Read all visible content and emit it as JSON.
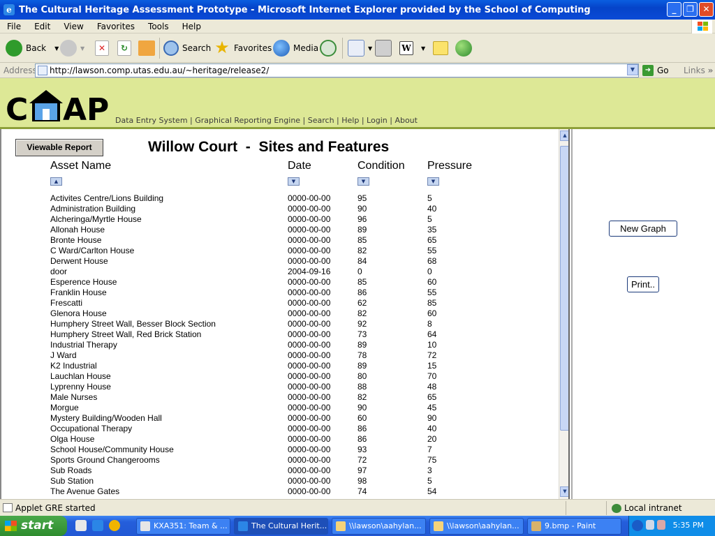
{
  "window": {
    "title": "The Cultural Heritage Assessment Prototype - Microsoft Internet Explorer provided by the School of Computing"
  },
  "menu": [
    "File",
    "Edit",
    "View",
    "Favorites",
    "Tools",
    "Help"
  ],
  "toolbar": {
    "back": "Back",
    "search": "Search",
    "favorites": "Favorites",
    "media": "Media"
  },
  "address": {
    "label": "Address",
    "url": "http://lawson.comp.utas.edu.au/~heritage/release2/",
    "go": "Go",
    "links": "Links"
  },
  "site": {
    "logo": "CHAP",
    "nav": [
      "Data Entry System",
      "Graphical Reporting Engine",
      "Search",
      "Help",
      "Login",
      "About"
    ]
  },
  "report": {
    "button": "Viewable Report",
    "title": "Willow Court  -  Sites and Features",
    "columns": [
      "Asset Name",
      "Date",
      "Condition",
      "Pressure"
    ],
    "rows": [
      [
        "Activites Centre/Lions Building",
        "0000-00-00",
        "95",
        "5"
      ],
      [
        "Administration Building",
        "0000-00-00",
        "90",
        "40"
      ],
      [
        "Alcheringa/Myrtle House",
        "0000-00-00",
        "96",
        "5"
      ],
      [
        "Allonah House",
        "0000-00-00",
        "89",
        "35"
      ],
      [
        "Bronte House",
        "0000-00-00",
        "85",
        "65"
      ],
      [
        "C Ward/Carlton House",
        "0000-00-00",
        "82",
        "55"
      ],
      [
        "Derwent House",
        "0000-00-00",
        "84",
        "68"
      ],
      [
        "door",
        "2004-09-16",
        "0",
        "0"
      ],
      [
        "Esperence House",
        "0000-00-00",
        "85",
        "60"
      ],
      [
        "Franklin House",
        "0000-00-00",
        "86",
        "55"
      ],
      [
        "Frescatti",
        "0000-00-00",
        "62",
        "85"
      ],
      [
        "Glenora House",
        "0000-00-00",
        "82",
        "60"
      ],
      [
        "Humphery Street Wall, Besser Block Section",
        "0000-00-00",
        "92",
        "8"
      ],
      [
        "Humphery Street Wall, Red Brick Station",
        "0000-00-00",
        "73",
        "64"
      ],
      [
        "Industrial Therapy",
        "0000-00-00",
        "89",
        "10"
      ],
      [
        "J Ward",
        "0000-00-00",
        "78",
        "72"
      ],
      [
        "K2 Industrial",
        "0000-00-00",
        "89",
        "15"
      ],
      [
        "Lauchlan House",
        "0000-00-00",
        "80",
        "70"
      ],
      [
        "Lyprenny House",
        "0000-00-00",
        "88",
        "48"
      ],
      [
        "Male Nurses",
        "0000-00-00",
        "82",
        "65"
      ],
      [
        "Morgue",
        "0000-00-00",
        "90",
        "45"
      ],
      [
        "Mystery Building/Wooden Hall",
        "0000-00-00",
        "60",
        "90"
      ],
      [
        "Occupational Therapy",
        "0000-00-00",
        "86",
        "40"
      ],
      [
        "Olga House",
        "0000-00-00",
        "86",
        "20"
      ],
      [
        "School House/Community House",
        "0000-00-00",
        "93",
        "7"
      ],
      [
        "Sports Ground Changerooms",
        "0000-00-00",
        "72",
        "75"
      ],
      [
        "Sub Roads",
        "0000-00-00",
        "97",
        "3"
      ],
      [
        "Sub Station",
        "0000-00-00",
        "98",
        "5"
      ],
      [
        "The Avenue Gates",
        "0000-00-00",
        "74",
        "54"
      ]
    ]
  },
  "side": {
    "new_graph": "New Graph",
    "print": "Print.."
  },
  "status": {
    "text": "Applet GRE started",
    "zone": "Local intranet"
  },
  "taskbar": {
    "start": "start",
    "tasks": [
      "KXA351: Team & ...",
      "The Cultural Herit...",
      "\\\\lawson\\aahylan...",
      "\\\\lawson\\aahylan...",
      "9.bmp - Paint"
    ],
    "clock": "5:35 PM"
  }
}
